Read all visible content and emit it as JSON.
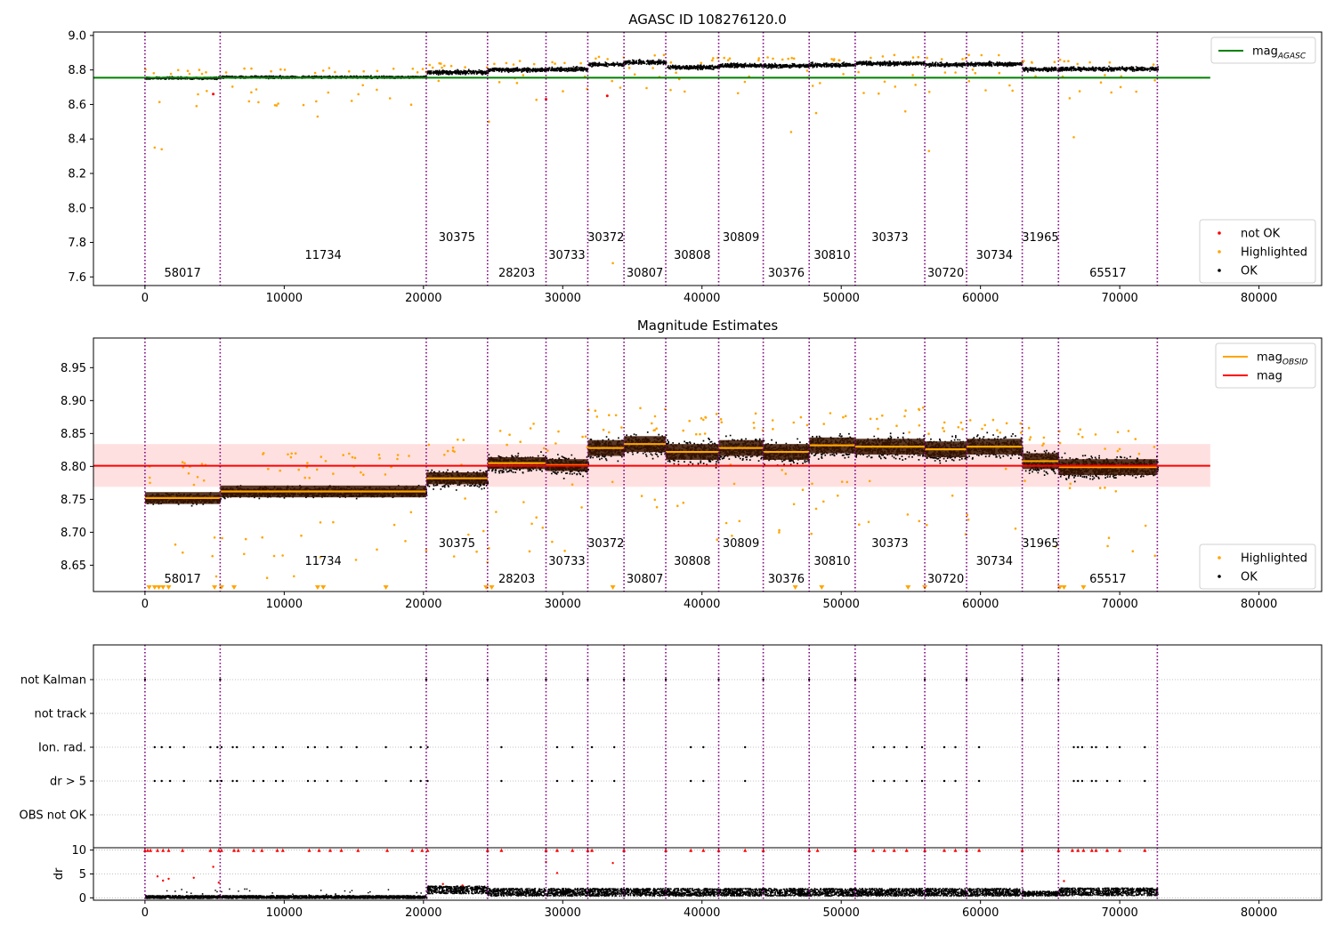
{
  "chart_data": [
    {
      "type": "scatter",
      "title": "AGASC ID 108276120.0",
      "xlabel": "",
      "ylabel": "",
      "xlim": [
        -3700,
        84500
      ],
      "ylim": [
        7.55,
        9.02
      ],
      "xticks": [
        0,
        10000,
        20000,
        30000,
        40000,
        50000,
        60000,
        70000,
        80000
      ],
      "yticks": [
        "7.6",
        "7.8",
        "8.0",
        "8.2",
        "8.4",
        "8.6",
        "8.8",
        "9.0"
      ],
      "grid": false,
      "reference_line": {
        "name": "mag",
        "subscript": "AGASC",
        "y": 8.755,
        "x_range": [
          -3700,
          76500
        ],
        "color": "#008000"
      },
      "legend_top": {
        "placement": "top-right",
        "entries": [
          {
            "name": "mag",
            "subscript": "AGASC",
            "color": "#008000",
            "kind": "line"
          }
        ]
      },
      "legend_bottom": {
        "placement": "bottom-right",
        "entries": [
          {
            "name": "not OK",
            "color": "#ff0000",
            "kind": "dot"
          },
          {
            "name": "Highlighted",
            "color": "#ffa500",
            "kind": "dot"
          },
          {
            "name": "OK",
            "color": "#000000",
            "kind": "dot"
          }
        ]
      }
    },
    {
      "type": "scatter",
      "title": "Magnitude Estimates",
      "xlabel": "",
      "ylabel": "",
      "xlim": [
        -3700,
        84500
      ],
      "ylim": [
        8.61,
        8.995
      ],
      "xticks": [
        0,
        10000,
        20000,
        30000,
        40000,
        50000,
        60000,
        70000,
        80000
      ],
      "yticks": [
        "8.65",
        "8.70",
        "8.75",
        "8.80",
        "8.85",
        "8.90",
        "8.95"
      ],
      "grid": false,
      "reference_line": {
        "name": "mag",
        "y": 8.801,
        "band": [
          8.769,
          8.834
        ],
        "x_range": [
          -3700,
          76500
        ],
        "color": "#ff0000"
      },
      "legend_top": {
        "placement": "top-right",
        "entries": [
          {
            "name": "mag",
            "subscript": "OBSID",
            "color": "#ffa500",
            "kind": "line"
          },
          {
            "name": "mag",
            "color": "#ff0000",
            "kind": "line"
          }
        ]
      },
      "legend_bottom": {
        "placement": "bottom-right",
        "entries": [
          {
            "name": "Highlighted",
            "color": "#ffa500",
            "kind": "dot"
          },
          {
            "name": "OK",
            "color": "#000000",
            "kind": "dot"
          }
        ]
      }
    },
    {
      "type": "scatter",
      "title": "",
      "xlabel": "",
      "ylabel": "",
      "xlim": [
        -3700,
        84500
      ],
      "grid": true,
      "flag_rows": [
        "not Kalman",
        "not track",
        "Ion. rad.",
        "dr > 5",
        "OBS not OK"
      ],
      "flag_points": {
        "not Kalman": [
          0,
          5400,
          20200,
          24600,
          28800,
          31800,
          34400,
          37400,
          41200,
          44400,
          47700,
          51000,
          56000,
          59000,
          63000,
          65600
        ],
        "Ion. rad.": [
          700,
          1200,
          1800,
          2800,
          4700,
          5200,
          5500,
          6300,
          6600,
          7800,
          8500,
          9400,
          9900,
          11700,
          12200,
          13100,
          14100,
          15200,
          17300,
          19100,
          19800,
          20300,
          25600,
          29600,
          30700,
          32100,
          33700,
          39200,
          40100,
          43100,
          52300,
          53100,
          53800,
          54700,
          55800,
          57400,
          58200,
          59900,
          66700,
          67000,
          67300,
          68000,
          68300,
          69100,
          70000,
          71800
        ],
        "dr > 5": [
          700,
          1200,
          1800,
          2800,
          4700,
          5200,
          5500,
          6300,
          6600,
          7800,
          8500,
          9400,
          9900,
          11700,
          12200,
          13100,
          14100,
          15200,
          17300,
          19100,
          19800,
          20300,
          25600,
          29600,
          30700,
          32100,
          33700,
          39200,
          40100,
          43100,
          52300,
          53100,
          53800,
          54700,
          55800,
          57400,
          58200,
          59900,
          66700,
          67000,
          67300,
          68000,
          68300,
          69100,
          70000,
          71800
        ]
      }
    },
    {
      "type": "scatter",
      "title": "",
      "xlabel": "",
      "ylabel": "dr",
      "xlim": [
        -3700,
        84500
      ],
      "ylim": [
        -0.5,
        10.5
      ],
      "xticks": [
        0,
        10000,
        20000,
        30000,
        40000,
        50000,
        60000,
        70000,
        80000
      ],
      "yticks": [
        "0",
        "5",
        "10"
      ],
      "grid": true,
      "clipped_marker_value": 10,
      "dr_levels": [
        {
          "x": [
            0,
            20200
          ],
          "median": 0.3,
          "spread": 0.3
        },
        {
          "x": [
            20200,
            24600
          ],
          "median": 1.8,
          "spread": 0.8
        },
        {
          "x": [
            24600,
            63000
          ],
          "median": 1.3,
          "spread": 0.8
        },
        {
          "x": [
            63000,
            65600
          ],
          "median": 1.0,
          "spread": 0.5
        },
        {
          "x": [
            65600,
            72700
          ],
          "median": 1.4,
          "spread": 0.8
        }
      ]
    }
  ],
  "obsids": [
    {
      "id": "58017",
      "start": 0,
      "end": 5400,
      "mag": 8.752,
      "mag_agasc": 8.757,
      "label_row": 3
    },
    {
      "id": "11734",
      "start": 5400,
      "end": 20200,
      "mag": 8.762,
      "mag_agasc": 8.762,
      "label_row": 2
    },
    {
      "id": "30375",
      "start": 20200,
      "end": 24600,
      "mag": 8.782,
      "mag_agasc": 8.79,
      "label_row": 1
    },
    {
      "id": "28203",
      "start": 24600,
      "end": 28800,
      "mag": 8.805,
      "mag_agasc": 8.805,
      "label_row": 3
    },
    {
      "id": "30733",
      "start": 28800,
      "end": 31800,
      "mag": 8.802,
      "mag_agasc": 8.808,
      "label_row": 2
    },
    {
      "id": "30372",
      "start": 31800,
      "end": 34400,
      "mag": 8.828,
      "mag_agasc": 8.835,
      "label_row": 1
    },
    {
      "id": "30807",
      "start": 34400,
      "end": 37400,
      "mag": 8.834,
      "mag_agasc": 8.848,
      "label_row": 3
    },
    {
      "id": "30808",
      "start": 37400,
      "end": 41200,
      "mag": 8.822,
      "mag_agasc": 8.82,
      "label_row": 2
    },
    {
      "id": "30809",
      "start": 41200,
      "end": 44400,
      "mag": 8.828,
      "mag_agasc": 8.83,
      "label_row": 1
    },
    {
      "id": "30376",
      "start": 44400,
      "end": 47700,
      "mag": 8.822,
      "mag_agasc": 8.828,
      "label_row": 3
    },
    {
      "id": "30810",
      "start": 47700,
      "end": 51000,
      "mag": 8.832,
      "mag_agasc": 8.832,
      "label_row": 2
    },
    {
      "id": "30373",
      "start": 51000,
      "end": 56000,
      "mag": 8.83,
      "mag_agasc": 8.842,
      "label_row": 1
    },
    {
      "id": "30720",
      "start": 56000,
      "end": 59000,
      "mag": 8.826,
      "mag_agasc": 8.835,
      "label_row": 3
    },
    {
      "id": "30734",
      "start": 59000,
      "end": 63000,
      "mag": 8.83,
      "mag_agasc": 8.838,
      "label_row": 2
    },
    {
      "id": "31965",
      "start": 63000,
      "end": 65600,
      "mag": 8.808,
      "mag_agasc": 8.808,
      "label_row": 1
    },
    {
      "id": "65517",
      "start": 65600,
      "end": 72700,
      "mag": 8.799,
      "mag_agasc": 8.81,
      "label_row": 3
    }
  ],
  "obs_boundaries": [
    0,
    5400,
    20200,
    24600,
    28800,
    31800,
    34400,
    37400,
    41200,
    44400,
    47700,
    51000,
    56000,
    59000,
    63000,
    65600,
    72700
  ],
  "colors": {
    "boundary": "#800080",
    "ok": "#000000",
    "highlighted": "#ffa500",
    "not_ok": "#ff0000",
    "mag_agasc_line": "#008000",
    "mag_line": "#ff0000",
    "mag_obsid_line": "#ffa500",
    "band": "#ffe0e0",
    "obs_box": "#3a1400"
  }
}
